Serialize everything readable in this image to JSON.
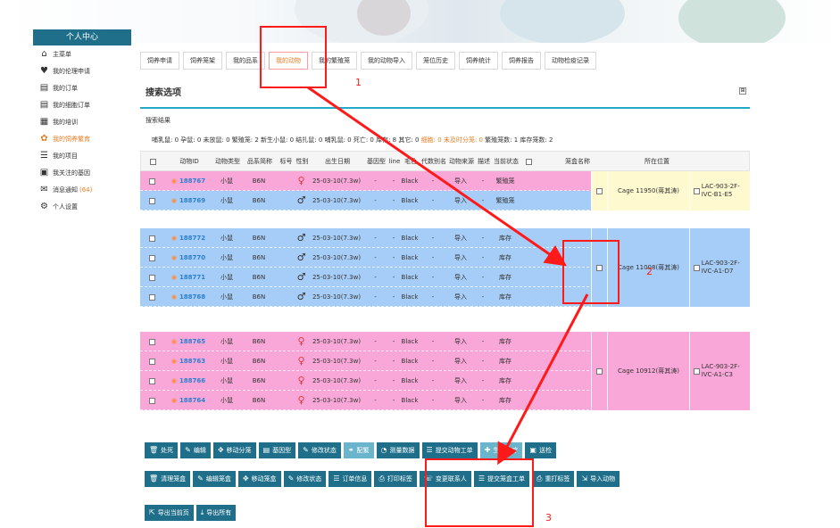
{
  "sidebar": {
    "title": "个人中心",
    "items": [
      {
        "label": "主菜单",
        "icon": "home-icon"
      },
      {
        "label": "我的伦理申请",
        "icon": "heart-icon"
      },
      {
        "label": "我的订单",
        "icon": "list-icon"
      },
      {
        "label": "我的细胞订单",
        "icon": "list-icon"
      },
      {
        "label": "我的培训",
        "icon": "training-icon"
      },
      {
        "label": "我的饲养繁育",
        "icon": "mouse-icon",
        "active": true
      },
      {
        "label": "我的项目",
        "icon": "project-icon"
      },
      {
        "label": "我关注的基因",
        "icon": "monitor-icon"
      },
      {
        "label": "消息通知",
        "icon": "mail-icon",
        "count": "(64)"
      },
      {
        "label": "个人设置",
        "icon": "gear-icon"
      }
    ]
  },
  "tabs": [
    "饲养申请",
    "饲养笼架",
    "我的品系",
    "我的动物",
    "我的繁殖笼",
    "我的动物导入",
    "笼位历史",
    "饲养统计",
    "饲养报告",
    "动物检疫记录"
  ],
  "active_tab": "我的动物",
  "panel": {
    "title": "搜索选项",
    "expand": "⊞"
  },
  "results_title": "搜索结果",
  "summary": {
    "prefix": "哺乳鼠: 0 孕鼠: 0 未放鼠: 0 繁殖笼: 2 新生小鼠: 0 结扎鼠: 0 哺乳鼠: 0 死亡: 0 库存: 8 其它: 0 ",
    "highlight": "细胞: 0 未及时分笼: 0",
    "suffix": "    繁殖笼数: 1 库存笼数: 2"
  },
  "table": {
    "headers": [
      "",
      "动物ID",
      "动物类型",
      "品系简称",
      "标号",
      "性别",
      "出生日期",
      "基因型",
      "line",
      "毛色",
      "代数别名",
      "动物来源",
      "描述",
      "当前状态",
      "",
      "笼盒名称",
      "所在位置"
    ],
    "cages": [
      {
        "cage_name": "Cage 11950(蒋其涛)",
        "location": "LAC-903-2F-IVC-B1-E5",
        "rows": [
          {
            "id": "188767",
            "type": "小鼠",
            "strain": "B6N",
            "sex": "female",
            "birth": "25-03-10(7.3w)",
            "genotype": "-",
            "line": "-",
            "color": "Black",
            "gen": "-",
            "source": "导入",
            "desc": "-",
            "status": "繁殖笼"
          },
          {
            "id": "188769",
            "type": "小鼠",
            "strain": "B6N",
            "sex": "male",
            "birth": "25-03-10(7.3w)",
            "genotype": "-",
            "line": "-",
            "color": "Black",
            "gen": "-",
            "source": "导入",
            "desc": "-",
            "status": "繁殖笼"
          }
        ]
      },
      {
        "cage_name": "Cage 11008(蒋其涛)",
        "location": "LAC-903-2F-IVC-A1-D7",
        "rows": [
          {
            "id": "188772",
            "type": "小鼠",
            "strain": "B6N",
            "sex": "male",
            "birth": "25-03-10(7.3w)",
            "genotype": "-",
            "line": "-",
            "color": "Black",
            "gen": "-",
            "source": "导入",
            "desc": "-",
            "status": "库存"
          },
          {
            "id": "188770",
            "type": "小鼠",
            "strain": "B6N",
            "sex": "male",
            "birth": "25-03-10(7.3w)",
            "genotype": "-",
            "line": "-",
            "color": "Black",
            "gen": "-",
            "source": "导入",
            "desc": "-",
            "status": "库存"
          },
          {
            "id": "188771",
            "type": "小鼠",
            "strain": "B6N",
            "sex": "male",
            "birth": "25-03-10(7.3w)",
            "genotype": "-",
            "line": "-",
            "color": "Black",
            "gen": "-",
            "source": "导入",
            "desc": "-",
            "status": "库存"
          },
          {
            "id": "188768",
            "type": "小鼠",
            "strain": "B6N",
            "sex": "male",
            "birth": "25-03-10(7.3w)",
            "genotype": "-",
            "line": "-",
            "color": "Black",
            "gen": "-",
            "source": "导入",
            "desc": "-",
            "status": "库存"
          }
        ]
      },
      {
        "cage_name": "Cage 10912(蒋其涛)",
        "location": "LAC-903-2F-IVC-A1-C3",
        "rows": [
          {
            "id": "188765",
            "type": "小鼠",
            "strain": "B6N",
            "sex": "female",
            "birth": "25-03-10(7.3w)",
            "genotype": "-",
            "line": "-",
            "color": "Black",
            "gen": "-",
            "source": "导入",
            "desc": "-",
            "status": "库存"
          },
          {
            "id": "188763",
            "type": "小鼠",
            "strain": "B6N",
            "sex": "female",
            "birth": "25-03-10(7.3w)",
            "genotype": "-",
            "line": "-",
            "color": "Black",
            "gen": "-",
            "source": "导入",
            "desc": "-",
            "status": "库存"
          },
          {
            "id": "188766",
            "type": "小鼠",
            "strain": "B6N",
            "sex": "female",
            "birth": "25-03-10(7.3w)",
            "genotype": "-",
            "line": "-",
            "color": "Black",
            "gen": "-",
            "source": "导入",
            "desc": "-",
            "status": "库存"
          },
          {
            "id": "188764",
            "type": "小鼠",
            "strain": "B6N",
            "sex": "female",
            "birth": "25-03-10(7.3w)",
            "genotype": "-",
            "line": "-",
            "color": "Black",
            "gen": "-",
            "source": "导入",
            "desc": "-",
            "status": "库存"
          }
        ]
      }
    ]
  },
  "buttons_row1": [
    {
      "label": "处死",
      "icon": "trash-icon"
    },
    {
      "label": "编辑",
      "icon": "edit-icon"
    },
    {
      "label": "移动分笼",
      "icon": "move-icon"
    },
    {
      "label": "基因型",
      "icon": "file-icon"
    },
    {
      "label": "修改状态",
      "icon": "edit-icon"
    },
    {
      "label": "配繁",
      "icon": "pair-icon",
      "light": true
    },
    {
      "label": "测量数据",
      "icon": "gauge-icon"
    },
    {
      "label": "提交动物工单",
      "icon": "list-icon"
    },
    {
      "label": "生病治疗",
      "icon": "medical-icon",
      "light": true
    },
    {
      "label": "送检",
      "icon": "box-icon"
    }
  ],
  "buttons_row2": [
    {
      "label": "清理笼盒",
      "icon": "trash-icon"
    },
    {
      "label": "编辑笼盒",
      "icon": "edit-icon"
    },
    {
      "label": "移动笼盒",
      "icon": "move-icon"
    },
    {
      "label": "修改状态",
      "icon": "edit-icon"
    },
    {
      "label": "订单信息",
      "icon": "list-icon"
    },
    {
      "label": "打印标签",
      "icon": "print-icon"
    },
    {
      "label": "变更联系人",
      "icon": "contact-icon"
    },
    {
      "label": "提交笼盒工单",
      "icon": "list-icon"
    },
    {
      "label": "重打标签",
      "icon": "print-icon"
    },
    {
      "label": "导入动物",
      "icon": "import-icon"
    }
  ],
  "buttons_row3": [
    {
      "label": "导出当前页",
      "icon": "export-icon"
    },
    {
      "label": "导出所有",
      "icon": "download-icon"
    }
  ],
  "annotations": [
    "1",
    "2",
    "3"
  ],
  "colors": {
    "primary": "#1f6f8a",
    "accent": "#e67e22",
    "pink_row": "#f9a7d8",
    "blue_row": "#a6cdf7",
    "yellow_cell": "#fff9d0",
    "annotation": "#ff1a1a"
  }
}
